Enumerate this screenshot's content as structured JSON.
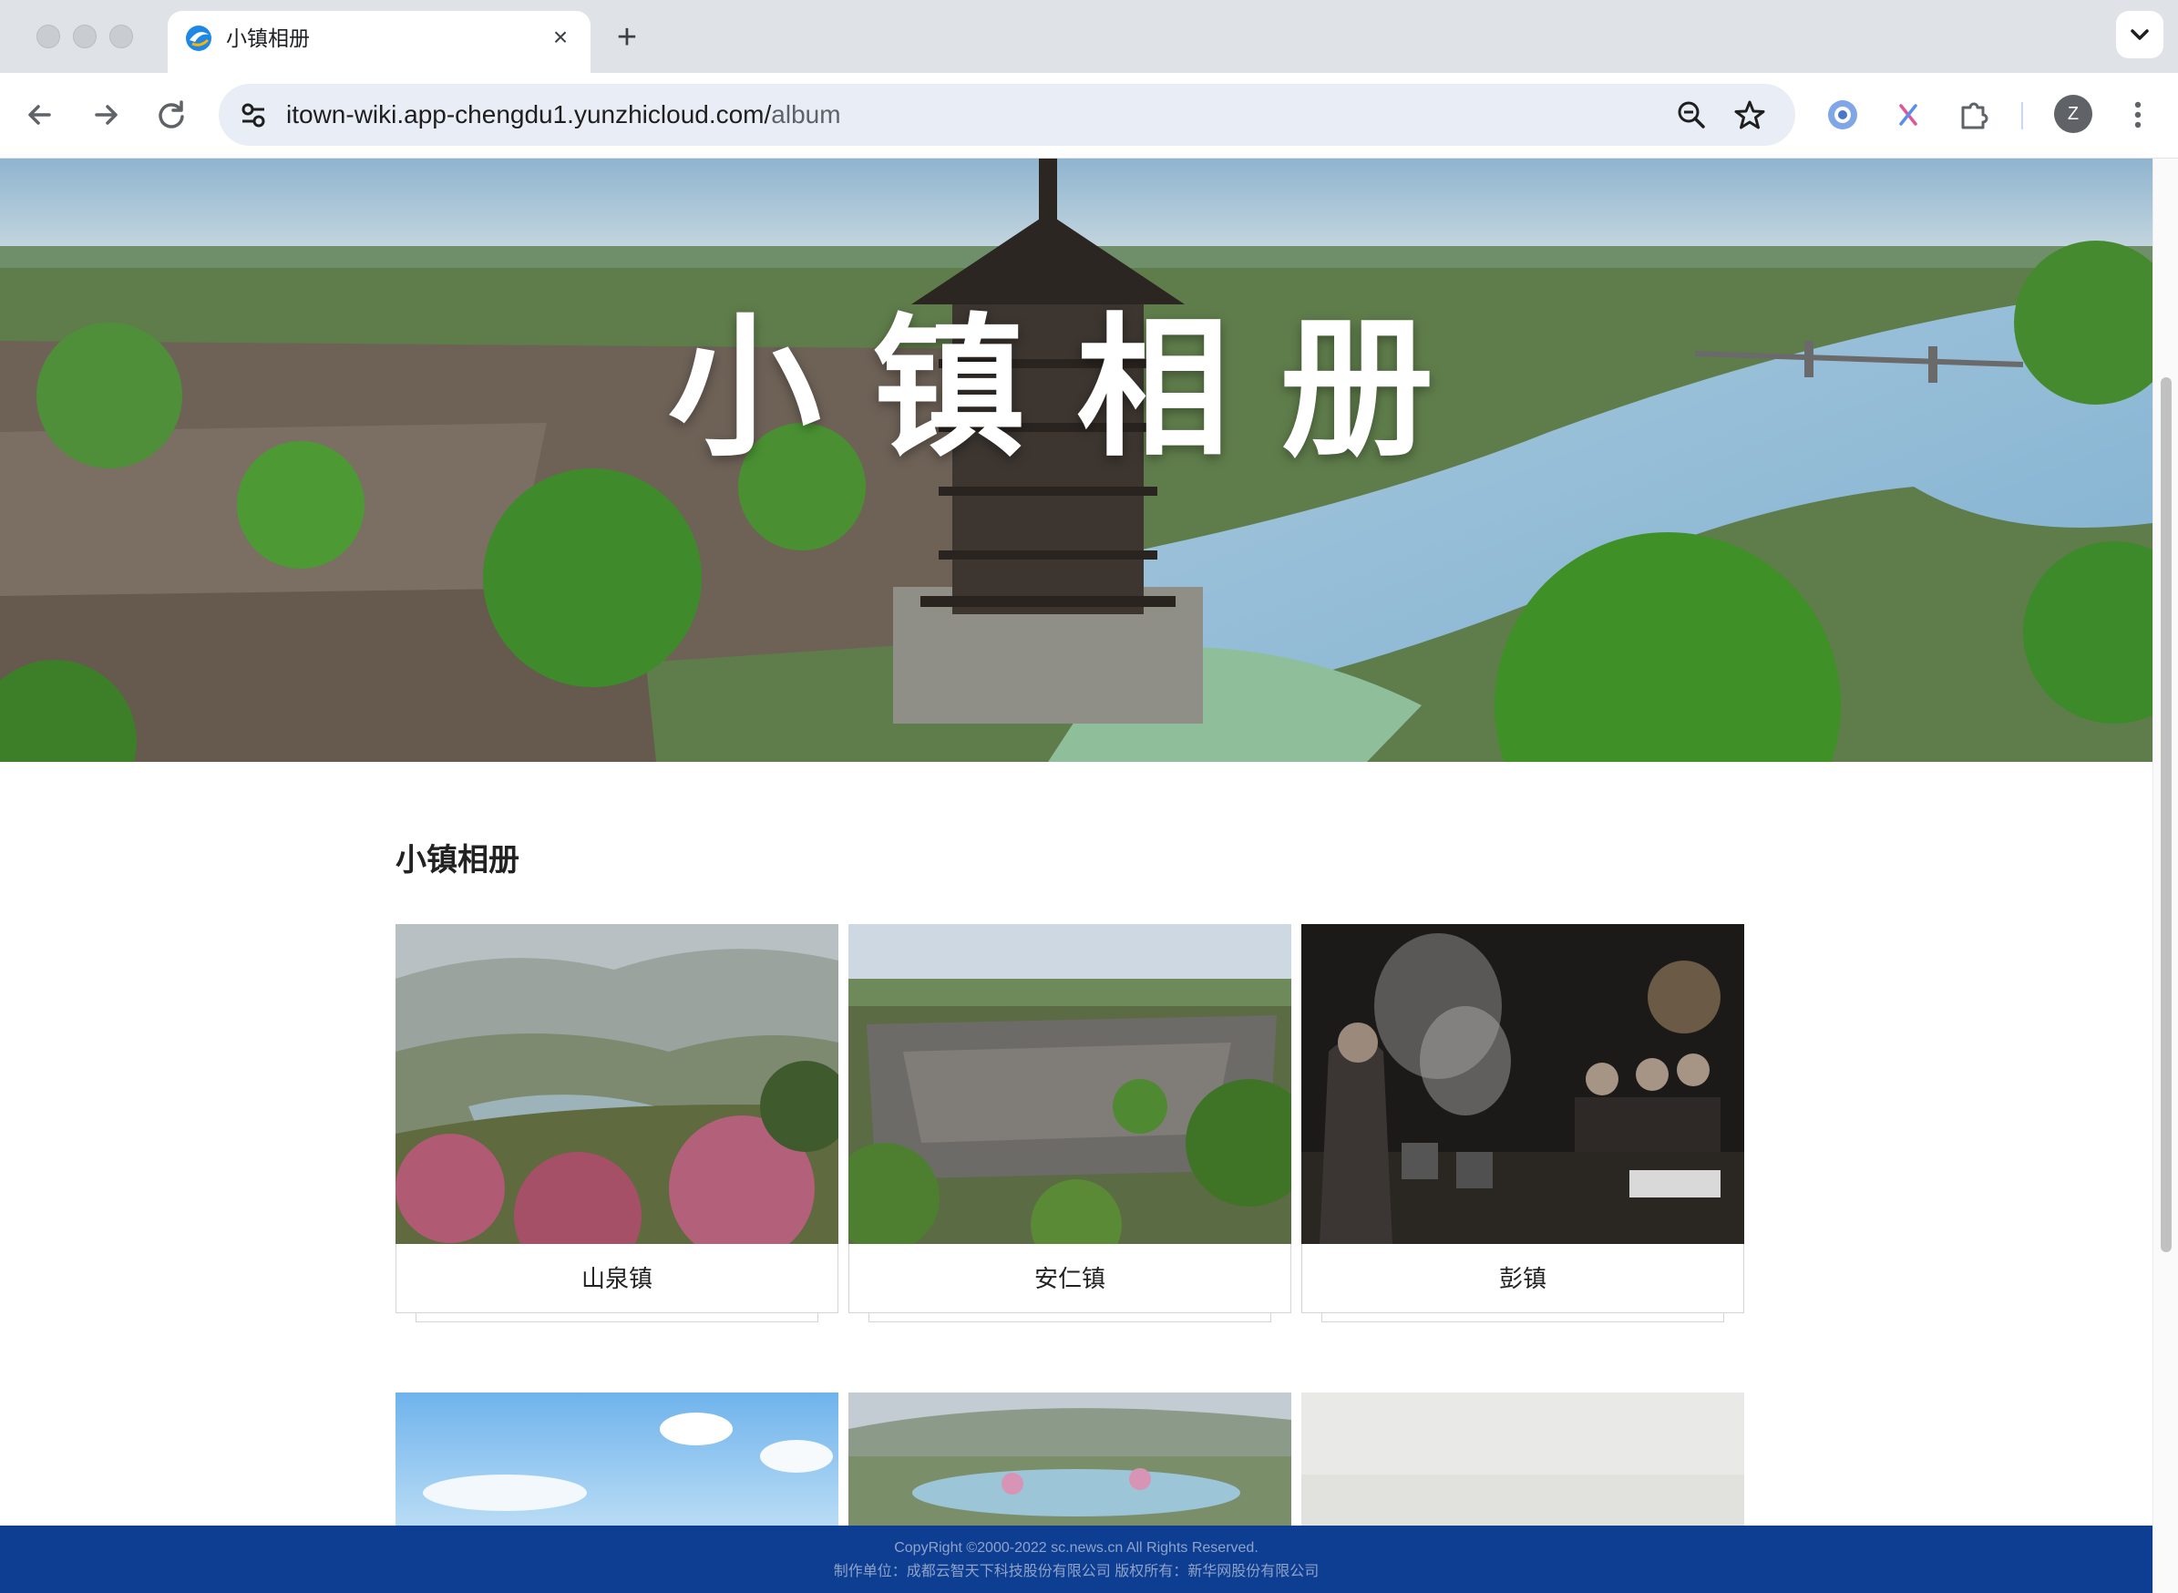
{
  "browser": {
    "tab_title": "小镇相册",
    "tab_close_icon": "×",
    "new_tab_icon": "+",
    "url_host": "itown-wiki.app-chengdu1.yunzhicloud.com/",
    "url_path": "album",
    "profile_initial": "Z"
  },
  "hero": {
    "title": "小镇相册"
  },
  "album": {
    "section_title": "小镇相册",
    "cards": [
      {
        "caption": "山泉镇"
      },
      {
        "caption": "安仁镇"
      },
      {
        "caption": "彭镇"
      }
    ]
  },
  "footer": {
    "copyright": "CopyRight ©2000-2022 sc.news.cn All Rights Reserved.",
    "producer": "制作单位：成都云智天下科技股份有限公司 版权所有：新华网股份有限公司"
  },
  "colors": {
    "footer_bg": "#0e3e91",
    "omnibox_bg": "#e9eef6",
    "tabstrip_bg": "#dfe3e8"
  }
}
